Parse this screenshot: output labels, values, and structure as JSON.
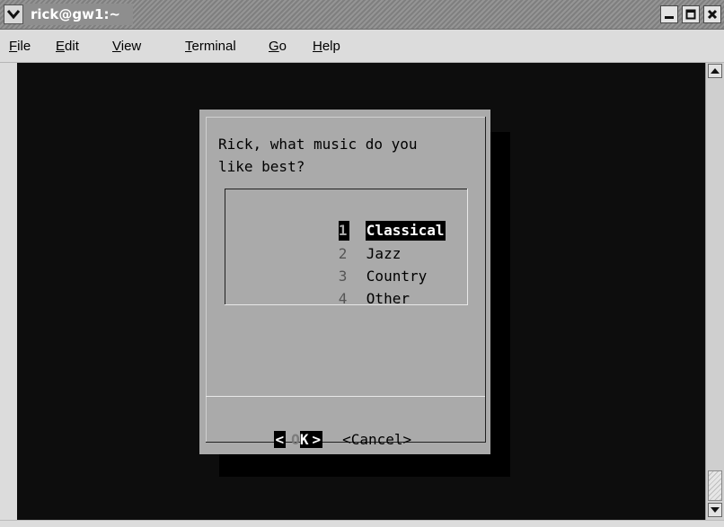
{
  "window": {
    "title": "rick@gw1:~",
    "menu_icon": "chevron-down-icon",
    "controls": [
      "minimize-icon",
      "maximize-icon",
      "close-icon"
    ]
  },
  "menubar": {
    "items": [
      {
        "first": "F",
        "rest": "ile"
      },
      {
        "first": "E",
        "rest": "dit"
      },
      {
        "first": "V",
        "rest": "iew"
      },
      {
        "first": "T",
        "rest": "erminal"
      },
      {
        "first": "G",
        "rest": "o"
      },
      {
        "first": "H",
        "rest": "elp"
      }
    ]
  },
  "dialog": {
    "prompt": "Rick, what music do you\nlike best?",
    "options": [
      {
        "tag": "1",
        "label": "Classical",
        "selected": true
      },
      {
        "tag": "2",
        "label": "Jazz",
        "selected": false
      },
      {
        "tag": "3",
        "label": "Country",
        "selected": false
      },
      {
        "tag": "4",
        "label": "Other",
        "selected": false
      }
    ],
    "ok_button": {
      "left": "<",
      "o": "O",
      "k": "K",
      "right": ">"
    },
    "cancel_button": "<Cancel>"
  },
  "colors": {
    "terminal_bg": "#0d0d0d",
    "dialog_bg": "#aaaaaa",
    "selection_bg": "#000000",
    "selection_fg": "#ffffff"
  }
}
